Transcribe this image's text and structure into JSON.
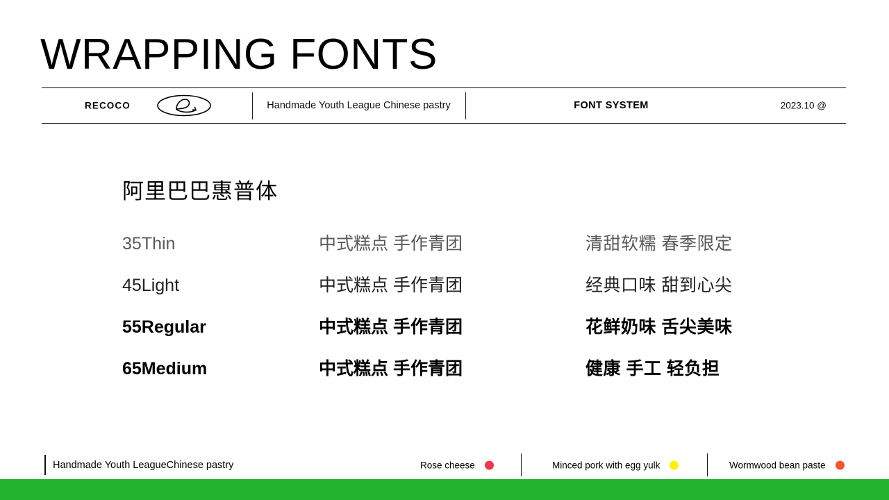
{
  "slide": {
    "title": "WRAPPING FONTS"
  },
  "header": {
    "brand": "RECOCO",
    "logo_icon": "recoco-swirl-logo",
    "subtitle": "Handmade Youth League  Chinese pastry",
    "section": "FONT SYSTEM",
    "date": "2023.10 @"
  },
  "main": {
    "font_name": "阿里巴巴惠普体",
    "columns": [
      "weight",
      "sample_a",
      "sample_b"
    ],
    "rows": [
      {
        "weight": "35Thin",
        "sample_a": "中式糕点 手作青团",
        "sample_b": "清甜软糯 春季限定"
      },
      {
        "weight": "45Light",
        "sample_a": "中式糕点 手作青团",
        "sample_b": "经典口味 甜到心尖"
      },
      {
        "weight": "55Regular",
        "sample_a": "中式糕点 手作青团",
        "sample_b": "花鲜奶味 舌尖美味"
      },
      {
        "weight": "65Medium",
        "sample_a": "中式糕点 手作青团",
        "sample_b": "健康  手工  轻负担"
      }
    ]
  },
  "footer": {
    "label": "Handmade Youth LeagueChinese pastry",
    "flavors": [
      {
        "name": "Rose cheese",
        "color": "#F4354D"
      },
      {
        "name": "Minced pork with egg yulk",
        "color": "#FFF000"
      },
      {
        "name": "Wormwood bean paste",
        "color": "#F4552A"
      }
    ]
  },
  "theme": {
    "accent_bar_color": "#22B32E",
    "background": "#FFFFFF",
    "text_color": "#111111"
  }
}
